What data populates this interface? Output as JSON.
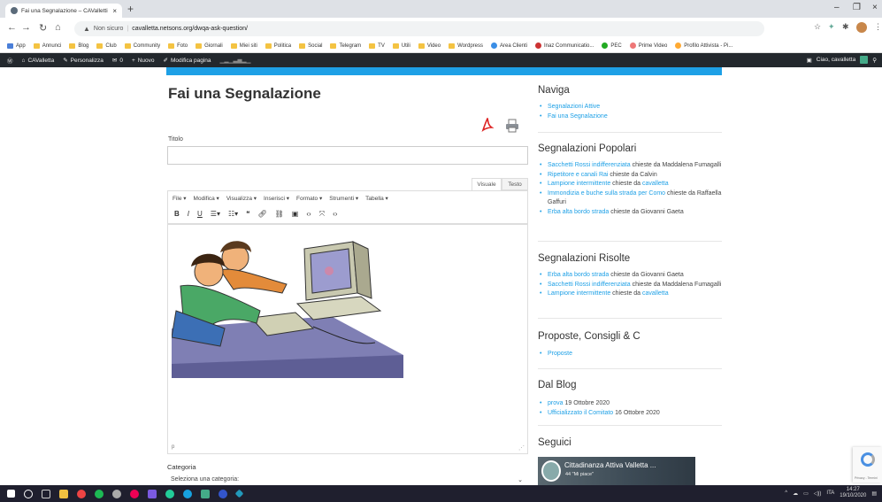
{
  "browser": {
    "tab_title": "Fai una Segnalazione – CAValletti",
    "tab_close": "×",
    "new_tab": "+",
    "address_warning": "Non sicuro",
    "address_url": "cavalletta.netsons.org/dwqa-ask-question/",
    "window_minimize": "–",
    "window_restore": "❐",
    "window_close": "×"
  },
  "bookmarks": [
    {
      "label": "App",
      "kind": "apps"
    },
    {
      "label": "Annunci",
      "kind": "folder"
    },
    {
      "label": "Blog",
      "kind": "folder"
    },
    {
      "label": "Club",
      "kind": "folder"
    },
    {
      "label": "Community",
      "kind": "folder"
    },
    {
      "label": "Foto",
      "kind": "folder"
    },
    {
      "label": "Giornali",
      "kind": "folder"
    },
    {
      "label": "Miei siti",
      "kind": "folder"
    },
    {
      "label": "Politica",
      "kind": "folder"
    },
    {
      "label": "Social",
      "kind": "folder"
    },
    {
      "label": "Telegram",
      "kind": "folder"
    },
    {
      "label": "TV",
      "kind": "folder"
    },
    {
      "label": "Utili",
      "kind": "folder"
    },
    {
      "label": "Video",
      "kind": "folder"
    },
    {
      "label": "Wordpress",
      "kind": "folder"
    },
    {
      "label": "Area Clienti",
      "kind": "site"
    },
    {
      "label": "Inaz Communicatio...",
      "kind": "site"
    },
    {
      "label": "PEC",
      "kind": "site"
    },
    {
      "label": "Prime Video",
      "kind": "site"
    },
    {
      "label": "Profilo Attivista - Pi...",
      "kind": "site"
    }
  ],
  "wpbar": {
    "site": "CAValletta",
    "customize": "Personalizza",
    "comments": "0",
    "new": "Nuovo",
    "edit": "Modifica pagina",
    "greeting": "Ciao, cavalletta"
  },
  "page": {
    "title": "Fai una Segnalazione",
    "title_label": "Titolo",
    "tab_visual": "Visuale",
    "tab_text": "Testo",
    "menu": [
      "File ▾",
      "Modifica ▾",
      "Visualizza ▾",
      "Inserisci ▾",
      "Formato ▾",
      "Strumenti ▾",
      "Tabella ▾"
    ],
    "path": "p",
    "category_label": "Categoria",
    "category_value": "Seleziona una categoria:"
  },
  "sidebar": {
    "naviga": {
      "title": "Naviga",
      "items": [
        "Segnalazioni Attive",
        "Fai una Segnalazione"
      ]
    },
    "popolari": {
      "title": "Segnalazioni Popolari",
      "items": [
        {
          "link": "Sacchetti Rossi indifferenziata",
          "text": " chieste da Maddalena Fumagalli",
          "link2": ""
        },
        {
          "link": "Ripetitore e canali Rai",
          "text": " chieste da Calvin",
          "link2": ""
        },
        {
          "link": "Lampione intermittente",
          "text": " chieste da ",
          "link2": "cavalletta"
        },
        {
          "link": "Immondizia e buche sulla strada per Como",
          "text": " chieste da Raffaella Gaffuri",
          "link2": ""
        },
        {
          "link": "Erba alta bordo strada",
          "text": " chieste da Giovanni Gaeta",
          "link2": ""
        }
      ]
    },
    "risolte": {
      "title": "Segnalazioni Risolte",
      "items": [
        {
          "link": "Erba alta bordo strada",
          "text": " chieste da Giovanni Gaeta",
          "link2": ""
        },
        {
          "link": "Sacchetti Rossi indifferenziata",
          "text": " chieste da Maddalena Fumagalli",
          "link2": ""
        },
        {
          "link": "Lampione intermittente",
          "text": " chieste da ",
          "link2": "cavalletta"
        }
      ]
    },
    "proposte": {
      "title": "Proposte, Consigli & C",
      "items": [
        "Proposte"
      ]
    },
    "blog": {
      "title": "Dal Blog",
      "items": [
        {
          "link": "prova",
          "text": " 19 Ottobre 2020"
        },
        {
          "link": "Ufficializzato il Comitato",
          "text": " 16 Ottobre 2020"
        }
      ]
    },
    "seguici": {
      "title": "Seguici",
      "fb_name": "Cittadinanza Attiva Valletta ...",
      "fb_likes": "44 \"Mi piace\""
    }
  },
  "recaptcha": {
    "label": "Privacy - Termini"
  },
  "taskbar": {
    "time": "14:27",
    "date": "19/10/2020",
    "lang": "ITA"
  }
}
